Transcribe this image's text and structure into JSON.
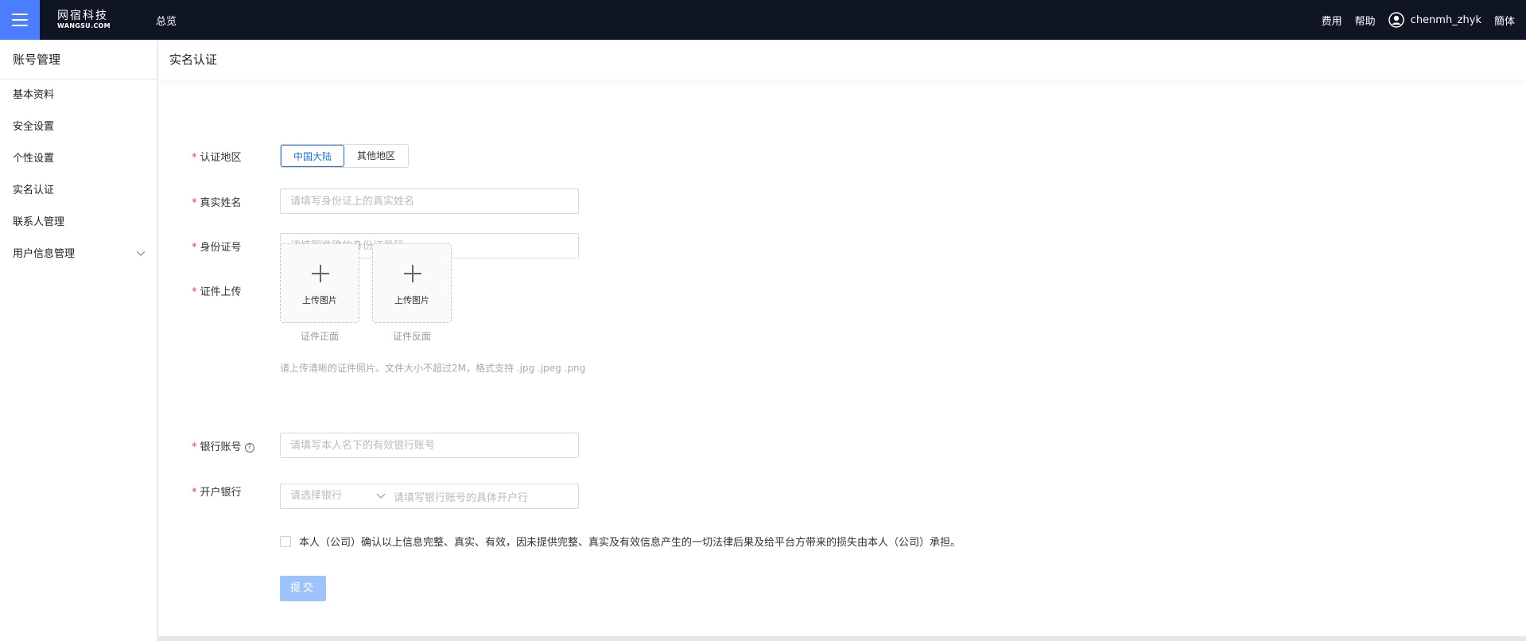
{
  "header": {
    "logo_cn": "网宿科技",
    "logo_en": "WANGSU.COM",
    "overview": "总览",
    "fees": "费用",
    "help": "帮助",
    "username": "chenmh_zhyk",
    "language": "簡体"
  },
  "sidebar": {
    "title": "账号管理",
    "items": [
      {
        "label": "基本资料"
      },
      {
        "label": "安全设置"
      },
      {
        "label": "个性设置"
      },
      {
        "label": "实名认证"
      },
      {
        "label": "联系人管理"
      },
      {
        "label": "用户信息管理"
      }
    ]
  },
  "page": {
    "title": "实名认证",
    "required_mark": "*"
  },
  "form": {
    "region_label": "认证地区",
    "region_options": [
      "中国大陆",
      "其他地区"
    ],
    "region_selected": "中国大陆",
    "name_label": "真实姓名",
    "name_placeholder": "请填写身份证上的真实姓名",
    "id_label": "身份证号",
    "id_placeholder": "请填写准确的身份证号码",
    "upload_label": "证件上传",
    "upload_front_button": "上传图片",
    "upload_back_button": "上传图片",
    "upload_front_caption": "证件正面",
    "upload_back_caption": "证件反面",
    "upload_hint": "请上传清晰的证件照片。文件大小不超过2M，格式支持 .jpg .jpeg .png",
    "bank_account_label": "银行账号",
    "bank_account_help": "?",
    "bank_account_placeholder": "请填写本人名下的有效银行账号",
    "bank_label": "开户银行",
    "bank_select_placeholder": "请选择银行",
    "bank_branch_placeholder": "请填写银行账号的具体开户行",
    "agreement": "本人（公司）确认以上信息完整、真实、有效，因未提供完整、真实及有效信息产生的一切法律后果及给平台方带来的损失由本人（公司）承担。",
    "submit": "提交"
  },
  "colors": {
    "topbar": "#0f1522",
    "menu_button": "#4c7cff",
    "accent": "#1d6fe3",
    "required": "#e8443a",
    "submit_disabled": "#9ec3fb"
  }
}
